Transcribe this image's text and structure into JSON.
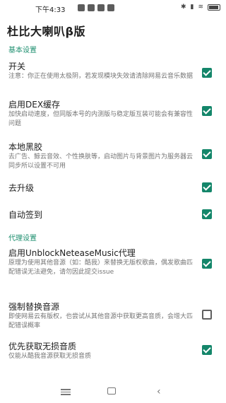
{
  "status": {
    "time": "下午4:33"
  },
  "app": {
    "title": "杜比大喇叭β版"
  },
  "sections": {
    "basic": {
      "header": "基本设置",
      "items": [
        {
          "title": "开关",
          "summary": "注意：你正在使用太极阴，若发现模块失效请清除网易云音乐数据",
          "checked": true
        },
        {
          "title": "启用DEX缓存",
          "summary": "加快启动速度，但同版本号的内测版与稳定版互装可能会有兼容性问题",
          "checked": true
        },
        {
          "title": "本地黑胶",
          "summary": "去广告、鲸云音效、个性换肤等，启动图片与背景图片为服务器云同步所以设置不可用",
          "checked": true
        },
        {
          "title": "去升级",
          "summary": "",
          "checked": true
        },
        {
          "title": "自动签到",
          "summary": "",
          "checked": true
        }
      ]
    },
    "proxy": {
      "header": "代理设置",
      "items": [
        {
          "title": "启用UnblockNeteaseMusic代理",
          "summary": "原理为使用其他音源（如：酷我）来替换无版权歌曲，偶发歌曲匹配错误无法避免，请勿因此提交issue",
          "checked": true
        },
        {
          "title": "强制替换音源",
          "summary": "即使网易云有版权，也尝试从其他音源中获取更高音质，会增大匹配错误概率",
          "checked": false
        },
        {
          "title": "优先获取无损音质",
          "summary": "仅能从酷我音源获取无损音质",
          "checked": true
        }
      ]
    }
  }
}
